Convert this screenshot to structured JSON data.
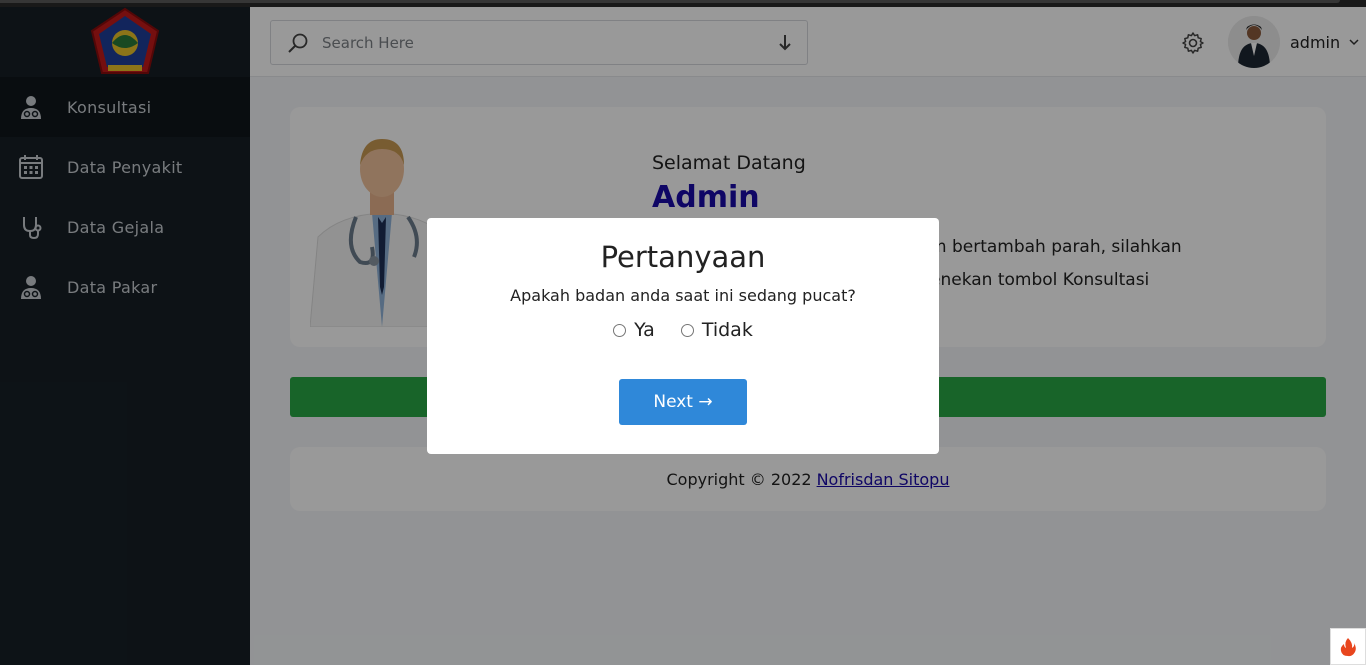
{
  "search": {
    "placeholder": "Search Here"
  },
  "user": {
    "name": "admin"
  },
  "sidebar": {
    "items": [
      {
        "label": "Konsultasi",
        "icon": "doctor-icon",
        "active": true
      },
      {
        "label": "Data Penyakit",
        "icon": "calendar-icon",
        "active": false
      },
      {
        "label": "Data Gejala",
        "icon": "stethoscope-icon",
        "active": false
      },
      {
        "label": "Data Pakar",
        "icon": "doctor-icon",
        "active": false
      }
    ]
  },
  "welcome": {
    "greeting": "Selamat Datang",
    "name": "Admin",
    "line1": "m bertambah parah, silahkan",
    "line2": "enekan tombol Konsultasi"
  },
  "footer": {
    "copyright": "Copyright © 2022",
    "author": "Nofrisdan Sitopu"
  },
  "modal": {
    "title": "Pertanyaan",
    "question": "Apakah badan anda saat ini sedang pucat?",
    "option_yes": "Ya",
    "option_no": "Tidak",
    "next_label": "Next →"
  },
  "colors": {
    "sidebar_bg": "#161f26",
    "accent_blue": "#2f88d9",
    "admin_text": "#1a0aa8",
    "green_bar": "#28a745"
  }
}
